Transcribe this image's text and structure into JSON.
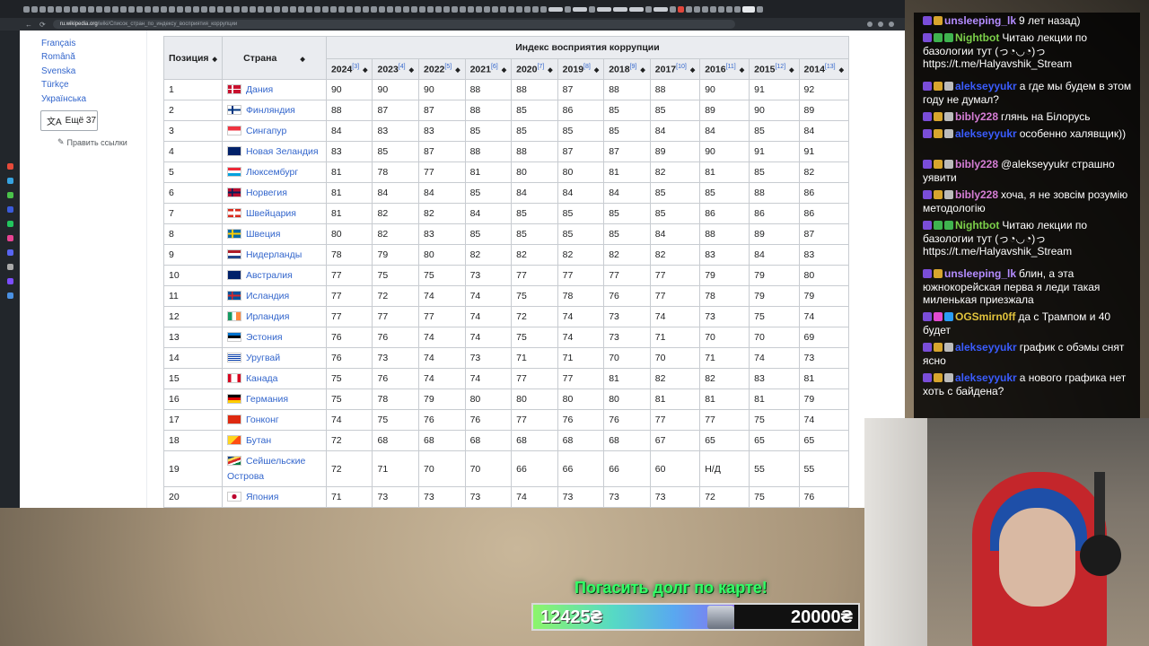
{
  "browser": {
    "url_domain": "ru.wikipedia.org",
    "url_path": "/wiki/Список_стран_по_индексу_восприятия_коррупции"
  },
  "sidebar": {
    "languages": [
      "Français",
      "Română",
      "Svenska",
      "Türkçe",
      "Українська"
    ],
    "more_languages": "Ещё 37",
    "edit_links": "Править ссылки"
  },
  "table": {
    "header_position": "Позиция",
    "header_country": "Страна",
    "header_group": "Индекс восприятия коррупции",
    "years": [
      {
        "year": "2024",
        "ref": "[3]"
      },
      {
        "year": "2023",
        "ref": "[4]"
      },
      {
        "year": "2022",
        "ref": "[5]"
      },
      {
        "year": "2021",
        "ref": "[6]"
      },
      {
        "year": "2020",
        "ref": "[7]"
      },
      {
        "year": "2019",
        "ref": "[8]"
      },
      {
        "year": "2018",
        "ref": "[9]"
      },
      {
        "year": "2017",
        "ref": "[10]"
      },
      {
        "year": "2016",
        "ref": "[11]"
      },
      {
        "year": "2015",
        "ref": "[12]"
      },
      {
        "year": "2014",
        "ref": "[13]"
      }
    ],
    "rows": [
      {
        "pos": "1",
        "country": "Дания",
        "flag": "dk",
        "values": [
          "90",
          "90",
          "90",
          "88",
          "88",
          "87",
          "88",
          "88",
          "90",
          "91",
          "92"
        ]
      },
      {
        "pos": "2",
        "country": "Финляндия",
        "flag": "fi",
        "values": [
          "88",
          "87",
          "87",
          "88",
          "85",
          "86",
          "85",
          "85",
          "89",
          "90",
          "89"
        ]
      },
      {
        "pos": "3",
        "country": "Сингапур",
        "flag": "sg",
        "values": [
          "84",
          "83",
          "83",
          "85",
          "85",
          "85",
          "85",
          "84",
          "84",
          "85",
          "84"
        ]
      },
      {
        "pos": "4",
        "country": "Новая Зеландия",
        "flag": "nz",
        "values": [
          "83",
          "85",
          "87",
          "88",
          "88",
          "87",
          "87",
          "89",
          "90",
          "91",
          "91"
        ]
      },
      {
        "pos": "5",
        "country": "Люксембург",
        "flag": "lu",
        "values": [
          "81",
          "78",
          "77",
          "81",
          "80",
          "80",
          "81",
          "82",
          "81",
          "85",
          "82"
        ]
      },
      {
        "pos": "6",
        "country": "Норвегия",
        "flag": "no",
        "values": [
          "81",
          "84",
          "84",
          "85",
          "84",
          "84",
          "84",
          "85",
          "85",
          "88",
          "86"
        ]
      },
      {
        "pos": "7",
        "country": "Швейцария",
        "flag": "ch",
        "values": [
          "81",
          "82",
          "82",
          "84",
          "85",
          "85",
          "85",
          "85",
          "86",
          "86",
          "86"
        ]
      },
      {
        "pos": "8",
        "country": "Швеция",
        "flag": "se",
        "values": [
          "80",
          "82",
          "83",
          "85",
          "85",
          "85",
          "85",
          "84",
          "88",
          "89",
          "87"
        ]
      },
      {
        "pos": "9",
        "country": "Нидерланды",
        "flag": "nl",
        "values": [
          "78",
          "79",
          "80",
          "82",
          "82",
          "82",
          "82",
          "82",
          "83",
          "84",
          "83"
        ]
      },
      {
        "pos": "10",
        "country": "Австралия",
        "flag": "au",
        "values": [
          "77",
          "75",
          "75",
          "73",
          "77",
          "77",
          "77",
          "77",
          "79",
          "79",
          "80"
        ]
      },
      {
        "pos": "11",
        "country": "Исландия",
        "flag": "is",
        "values": [
          "77",
          "72",
          "74",
          "74",
          "75",
          "78",
          "76",
          "77",
          "78",
          "79",
          "79"
        ]
      },
      {
        "pos": "12",
        "country": "Ирландия",
        "flag": "ie",
        "values": [
          "77",
          "77",
          "77",
          "74",
          "72",
          "74",
          "73",
          "74",
          "73",
          "75",
          "74"
        ]
      },
      {
        "pos": "13",
        "country": "Эстония",
        "flag": "ee",
        "values": [
          "76",
          "76",
          "74",
          "74",
          "75",
          "74",
          "73",
          "71",
          "70",
          "70",
          "69"
        ]
      },
      {
        "pos": "14",
        "country": "Уругвай",
        "flag": "uy",
        "values": [
          "76",
          "73",
          "74",
          "73",
          "71",
          "71",
          "70",
          "70",
          "71",
          "74",
          "73"
        ]
      },
      {
        "pos": "15",
        "country": "Канада",
        "flag": "ca",
        "values": [
          "75",
          "76",
          "74",
          "74",
          "77",
          "77",
          "81",
          "82",
          "82",
          "83",
          "81"
        ]
      },
      {
        "pos": "16",
        "country": "Германия",
        "flag": "de",
        "values": [
          "75",
          "78",
          "79",
          "80",
          "80",
          "80",
          "80",
          "81",
          "81",
          "81",
          "79"
        ]
      },
      {
        "pos": "17",
        "country": "Гонконг",
        "flag": "hk",
        "values": [
          "74",
          "75",
          "76",
          "76",
          "77",
          "76",
          "76",
          "77",
          "77",
          "75",
          "74"
        ]
      },
      {
        "pos": "18",
        "country": "Бутан",
        "flag": "bt",
        "values": [
          "72",
          "68",
          "68",
          "68",
          "68",
          "68",
          "68",
          "67",
          "65",
          "65",
          "65"
        ]
      },
      {
        "pos": "19",
        "country": "Сейшельские Острова",
        "flag": "sc",
        "values": [
          "72",
          "71",
          "70",
          "70",
          "66",
          "66",
          "66",
          "60",
          "Н/Д",
          "55",
          "55"
        ]
      },
      {
        "pos": "20",
        "country": "Япония",
        "flag": "jp",
        "values": [
          "71",
          "73",
          "73",
          "73",
          "74",
          "73",
          "73",
          "73",
          "72",
          "75",
          "76"
        ]
      }
    ]
  },
  "chat": {
    "messages": [
      {
        "user": "unsleeping_lk",
        "user_color": "#b48cff",
        "text": "9 лет назад)",
        "badges": [
          "#7a4dd8",
          "#d7a52e"
        ]
      },
      {
        "user": "Nightbot",
        "user_color": "#7cd04a",
        "text": "Читаю лекции по базологии тут (っ◔◡◔)っ https://t.me/Halyavshik_Stream",
        "badges": [
          "#7a4dd8",
          "#3fb34f",
          "#3fb34f"
        ]
      },
      {
        "user": "alekseyyukr",
        "user_color": "#3a5cff",
        "text": "а где мы будем в этом году не думал?",
        "badges": [
          "#7a4dd8",
          "#d7a52e",
          "#bbbbbb"
        ]
      },
      {
        "user": "bibly228",
        "user_color": "#d67ed6",
        "text": "глянь на Білорусь",
        "badges": [
          "#7a4dd8",
          "#d7a52e",
          "#bbbbbb"
        ]
      },
      {
        "user": "alekseyyukr",
        "user_color": "#3a5cff",
        "text": "особенно халявщик))",
        "badges": [
          "#7a4dd8",
          "#d7a52e",
          "#bbbbbb"
        ]
      },
      {
        "user": "bibly228",
        "user_color": "#d67ed6",
        "text": "@alekseyyukr страшно уявити",
        "badges": [
          "#7a4dd8",
          "#d7a52e",
          "#bbbbbb"
        ]
      },
      {
        "user": "bibly228",
        "user_color": "#d67ed6",
        "text": "хоча, я не зовсім розумію методологію",
        "badges": [
          "#7a4dd8",
          "#d7a52e",
          "#bbbbbb"
        ]
      },
      {
        "user": "Nightbot",
        "user_color": "#7cd04a",
        "text": "Читаю лекции по базологии тут (っ◔◡◔)っ https://t.me/Halyavshik_Stream",
        "badges": [
          "#7a4dd8",
          "#3fb34f",
          "#3fb34f"
        ]
      },
      {
        "user": "unsleeping_lk",
        "user_color": "#b48cff",
        "text": "блин, а эта южнокорейская перва я леди такая миленькая приезжала",
        "badges": [
          "#7a4dd8",
          "#d7a52e"
        ]
      },
      {
        "user": "OGSmirn0ff",
        "user_color": "#e0c23c",
        "text": "да с Трампом и 40 будет",
        "badges": [
          "#7a4dd8",
          "#e24ad0",
          "#2a9df4"
        ]
      },
      {
        "user": "alekseyyukr",
        "user_color": "#3a5cff",
        "text": "график с обэмы снят ясно",
        "badges": [
          "#7a4dd8",
          "#d7a52e",
          "#bbbbbb"
        ]
      },
      {
        "user": "alekseyyukr",
        "user_color": "#3a5cff",
        "text": "а нового графика нет хоть с байдена?",
        "badges": [
          "#7a4dd8",
          "#d7a52e",
          "#bbbbbb"
        ]
      }
    ]
  },
  "donation": {
    "title": "Погасить долг по карте!",
    "current": "12425₴",
    "goal": "20000₴",
    "progress_fraction": 0.62
  }
}
